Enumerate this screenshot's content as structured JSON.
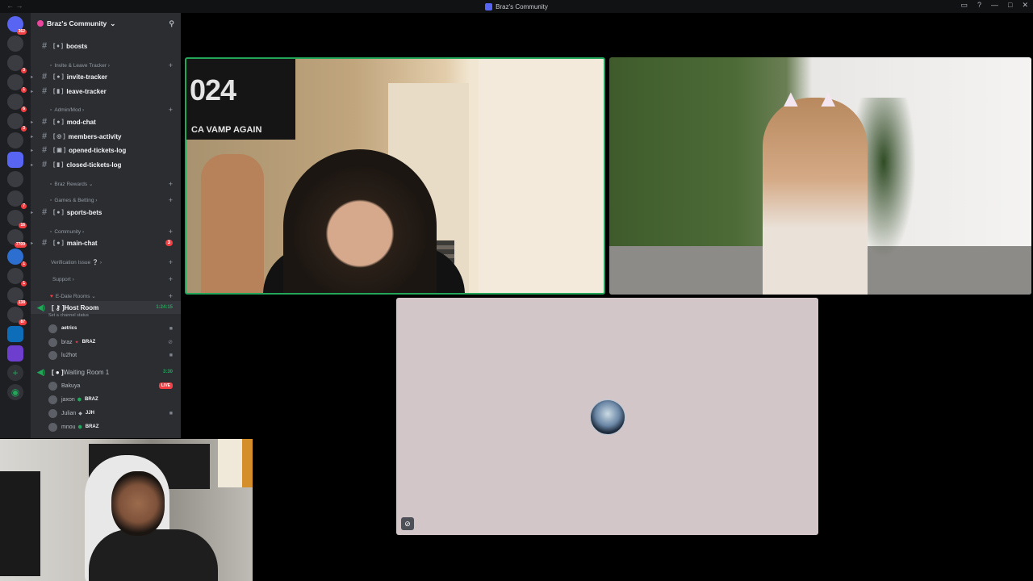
{
  "window": {
    "title": "Braz's Community"
  },
  "rail": {
    "badges": [
      "362",
      "",
      "3",
      "1",
      "6",
      "3",
      "",
      "",
      "",
      "7",
      "16",
      "7709",
      "1",
      "1",
      "138",
      "87",
      "",
      ""
    ]
  },
  "server": {
    "name": "Braz's Community"
  },
  "channels": {
    "boosts": "boosts",
    "cat_invite": "Invite & Leave Tracker",
    "invite_tracker": "invite-tracker",
    "leave_tracker": "leave-tracker",
    "cat_admin": "Admin/Mod",
    "mod_chat": "mod-chat",
    "members_activity": "members-activity",
    "opened_tickets": "opened-tickets-log",
    "closed_tickets": "closed-tickets-log",
    "cat_rewards": "Braz Rewards",
    "cat_games": "Games & Betting",
    "sports_bets": "sports-bets",
    "cat_community": "Community",
    "main_chat": "main-chat",
    "main_chat_badge": "3",
    "cat_verification": "Verification Issue",
    "cat_support": "Support",
    "cat_edate": "E-Date Rooms",
    "host_room": "Host Room",
    "host_room_time": "1:24:15",
    "host_room_status": "Set a channel status",
    "host_users": [
      {
        "name": "aetrics",
        "tag": ""
      },
      {
        "name": "braz",
        "tag": "BRAZ"
      },
      {
        "name": "lu2hot",
        "tag": ""
      }
    ],
    "waiting_room": "Waiting Room 1",
    "waiting_room_time": "3:30",
    "waiting_users": [
      {
        "name": "Bakuya",
        "tag": ""
      },
      {
        "name": "jaxon",
        "tag": "BRAZ"
      },
      {
        "name": "Julian",
        "tag": "JJH"
      },
      {
        "name": "mnou",
        "tag": "BRAZ"
      }
    ],
    "live_label": "LIVE"
  },
  "tiles": {
    "tile1_flag_big": "024",
    "tile1_flag_small": "CA VAMP AGAIN"
  },
  "colors": {
    "accent_green": "#23a55a",
    "alert_red": "#f23f43",
    "sidebar_bg": "#2b2d31",
    "rail_bg": "#1e1f22"
  }
}
